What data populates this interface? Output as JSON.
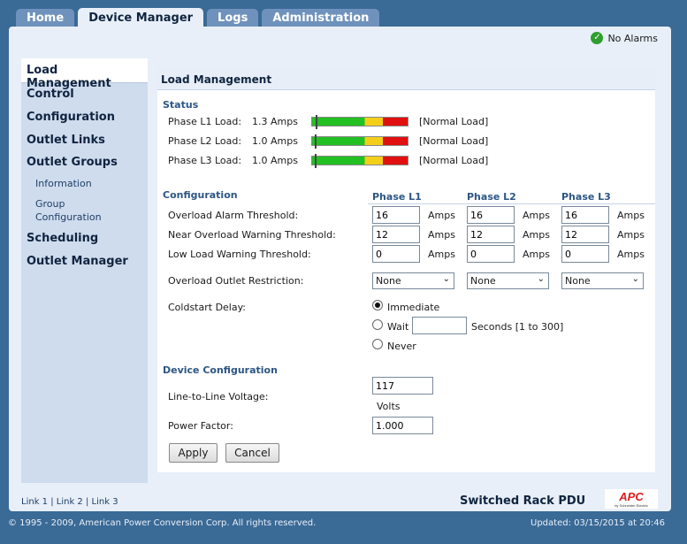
{
  "tabs": [
    {
      "label": "Home"
    },
    {
      "label": "Device Manager"
    },
    {
      "label": "Logs"
    },
    {
      "label": "Administration"
    }
  ],
  "alarm": {
    "text": "No Alarms"
  },
  "sidebar": {
    "items": [
      "Load Management",
      "Control",
      "Configuration",
      "Outlet Links",
      "Outlet Groups"
    ],
    "sub": [
      "Information",
      "Group",
      "Configuration"
    ],
    "items2": [
      "Scheduling",
      "Outlet Manager"
    ]
  },
  "content": {
    "title": "Load Management",
    "status": {
      "heading": "Status",
      "rows": [
        {
          "label": "Phase L1 Load:",
          "value": "1.3 Amps",
          "state": "[Normal Load]"
        },
        {
          "label": "Phase L2 Load:",
          "value": "1.0 Amps",
          "state": "[Normal Load]"
        },
        {
          "label": "Phase L3 Load:",
          "value": "1.0 Amps",
          "state": "[Normal Load]"
        }
      ]
    },
    "config": {
      "heading": "Configuration",
      "phases": [
        "Phase L1",
        "Phase L2",
        "Phase L3"
      ],
      "unit": "Amps",
      "rows": [
        {
          "label": "Overload Alarm Threshold:",
          "values": [
            "16",
            "16",
            "16"
          ]
        },
        {
          "label": "Near Overload Warning Threshold:",
          "values": [
            "12",
            "12",
            "12"
          ]
        },
        {
          "label": "Low Load Warning Threshold:",
          "values": [
            "0",
            "0",
            "0"
          ]
        }
      ],
      "restriction_label": "Overload Outlet Restriction:",
      "restriction_values": [
        "None",
        "None",
        "None"
      ],
      "coldstart_label": "Coldstart Delay:",
      "coldstart_options": [
        "Immediate",
        "Wait",
        "Never"
      ],
      "wait_value": "",
      "wait_suffix": "Seconds [1 to 300]"
    },
    "device": {
      "heading": "Device Configuration",
      "voltage_label": "Line-to-Line Voltage:",
      "voltage_value": "117",
      "voltage_unit": "Volts",
      "pf_label": "Power Factor:",
      "pf_value": "1.000"
    },
    "buttons": {
      "apply": "Apply",
      "cancel": "Cancel"
    }
  },
  "footer": {
    "links": [
      "Link 1",
      "Link 2",
      "Link 3"
    ],
    "product": "Switched Rack PDU",
    "brand": "APC",
    "brand_sub": "by Schneider Electric",
    "copyright": "© 1995 - 2009, American Power Conversion Corp. All rights reserved.",
    "updated": "Updated: 03/15/2015 at 20:46"
  },
  "colors": {
    "accent": "#2d5684",
    "background": "#3a6a96"
  }
}
